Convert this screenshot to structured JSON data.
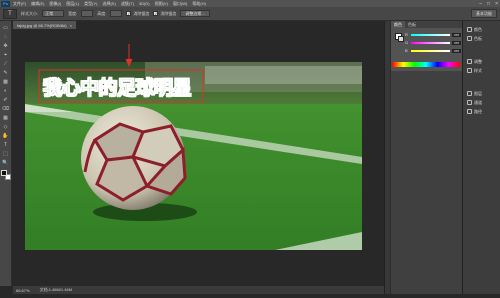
{
  "menubar": {
    "logo": "Ps",
    "items": [
      "文件(F)",
      "编辑(E)",
      "图像(I)",
      "图层(L)",
      "类型(Y)",
      "选择(S)",
      "滤镜(T)",
      "3D(D)",
      "视图(V)",
      "窗口(W)",
      "帮助(H)"
    ],
    "controls": [
      "–",
      "□",
      "×"
    ]
  },
  "options": {
    "tool_icon": "T",
    "size_label": "样式大小:",
    "size_value": "正常",
    "width_label": "宽度:",
    "height_label": "高度:",
    "antialias_label": "消除锯齿",
    "align_label": "调整边缘...",
    "refine_label": "消除锯齿",
    "adjust_button": "调整边缘...",
    "workspace": "基本功能"
  },
  "document": {
    "tab_title": "fajdg.jpg @ 66.7%(RGB/8#)",
    "close": "×",
    "headline": "我心中的足球明星",
    "zoom": "66.67%",
    "doc_info": "文档:1.46M/1.46M"
  },
  "tools": [
    "▭",
    "◌",
    "✥",
    "⌖",
    "⟋",
    "✎",
    "▩",
    "◐",
    "✐",
    "⌫",
    "▦",
    "◇",
    "✋",
    "T",
    "⬚",
    "🔍"
  ],
  "color_panel": {
    "tabs": [
      "颜色",
      "色板"
    ],
    "rows": [
      {
        "label": "R",
        "value": "255"
      },
      {
        "label": "G",
        "value": "255"
      },
      {
        "label": "B",
        "value": "255"
      }
    ]
  },
  "right_dock": {
    "items": [
      "颜色",
      "色板",
      "调整",
      "样式",
      "图层",
      "通道",
      "路径"
    ]
  },
  "colors": {
    "accent_red": "#e0312a",
    "text_green": "#3e9a32"
  }
}
